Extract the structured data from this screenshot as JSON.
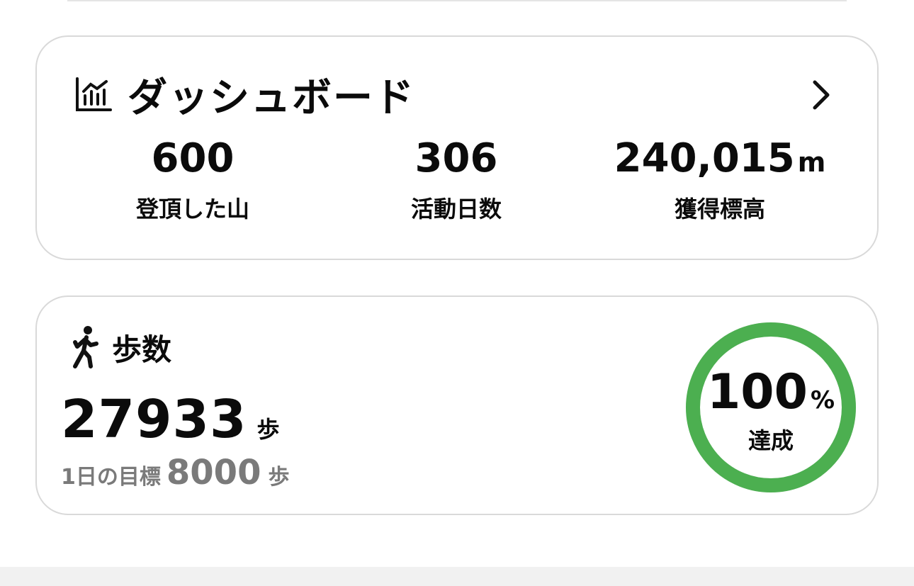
{
  "dashboard": {
    "icon": "chart-icon",
    "title": "ダッシュボード",
    "stats": [
      {
        "value": "600",
        "unit": "",
        "label": "登頂した山"
      },
      {
        "value": "306",
        "unit": "",
        "label": "活動日数"
      },
      {
        "value": "240,015",
        "unit": "m",
        "label": "獲得標高"
      }
    ]
  },
  "steps": {
    "icon": "walking-person-icon",
    "title": "歩数",
    "count": "27933",
    "count_unit": "歩",
    "goal_label": "1日の目標",
    "goal_value": "8000",
    "goal_unit": "歩",
    "progress_percent": "100",
    "progress_sign": "%",
    "progress_fraction": 1.0,
    "progress_label": "達成",
    "ring_color": "#4caf50"
  }
}
